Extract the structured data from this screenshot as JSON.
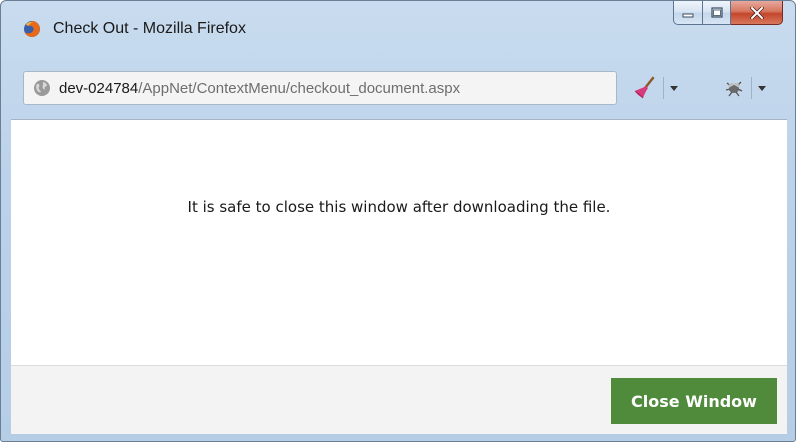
{
  "window": {
    "title": "Check Out - Mozilla Firefox",
    "app_icon": "firefox-icon",
    "controls": {
      "minimize_icon": "minimize-icon",
      "maximize_icon": "maximize-icon",
      "close_icon": "close-icon"
    }
  },
  "urlbar": {
    "site_icon": "globe-icon",
    "host": "dev-024784",
    "path": "/AppNet/ContextMenu/checkout_document.aspx"
  },
  "toolbar": {
    "addon1_icon": "broom-icon",
    "addon2_icon": "bug-icon"
  },
  "page": {
    "message": "It is safe to close this window after downloading the file.",
    "close_button_label": "Close Window"
  },
  "colors": {
    "button_green": "#4f8b3b",
    "frame_blue": "#bcd2ea",
    "close_red": "#c3462c"
  }
}
